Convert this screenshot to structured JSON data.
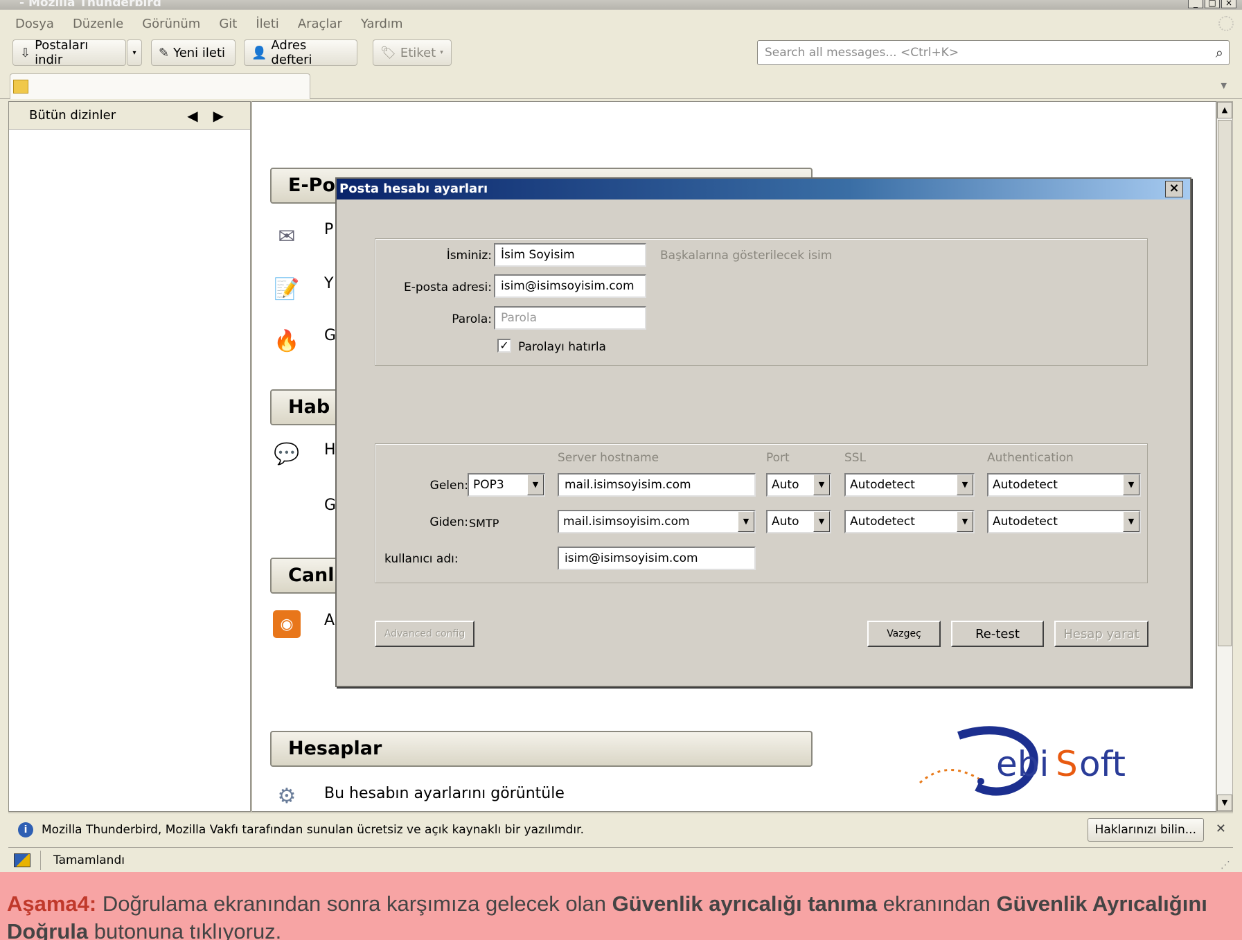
{
  "window": {
    "title": "- Mozilla Thunderbird"
  },
  "menubar": {
    "items": [
      "Dosya",
      "Düzenle",
      "Görünüm",
      "Git",
      "İleti",
      "Araçlar",
      "Yardım"
    ]
  },
  "toolbar": {
    "get_mail": "Postaları indir",
    "write": "Yeni ileti",
    "address_book": "Adres defteri",
    "tag": "Etiket",
    "search_placeholder": "Search all messages... <Ctrl+K>"
  },
  "folder_pane": {
    "header": "Bütün dizinler"
  },
  "home": {
    "sections": [
      {
        "title": "E-Po",
        "items": [
          "P",
          "Y",
          "G"
        ]
      },
      {
        "title": "Hab",
        "items": [
          "H",
          "G"
        ]
      },
      {
        "title": "Canl",
        "items": [
          "A"
        ]
      },
      {
        "title": "Hesaplar",
        "items": [
          "Bu hesabın ayarlarını görüntüle"
        ]
      }
    ]
  },
  "dialog": {
    "title": "Posta hesabı ayarları",
    "name_label": "İsminiz:",
    "name_value": "İsim Soyisim",
    "name_hint": "Başkalarına gösterilecek isim",
    "email_label": "E-posta adresi:",
    "email_value": "isim@isimsoyisim.com",
    "password_label": "Parola:",
    "password_placeholder": "Parola",
    "remember_label": "Parolayı hatırla",
    "col_hostname": "Server hostname",
    "col_port": "Port",
    "col_ssl": "SSL",
    "col_auth": "Authentication",
    "incoming_label": "Gelen:",
    "incoming_protocol": "POP3",
    "incoming_host": "mail.isimsoyisim.com",
    "incoming_port": "Auto",
    "incoming_ssl": "Autodetect",
    "incoming_auth": "Autodetect",
    "outgoing_label": "Giden:",
    "outgoing_protocol": "SMTP",
    "outgoing_host": "mail.isimsoyisim.com",
    "outgoing_port": "Auto",
    "outgoing_ssl": "Autodetect",
    "outgoing_auth": "Autodetect",
    "username_label": "kullanıcı adı:",
    "username_value": "isim@isimsoyisim.com",
    "advanced_button": "Advanced config",
    "cancel_button": "Vazgeç",
    "retest_button": "Re-test",
    "create_button": "Hesap yarat"
  },
  "notification": {
    "text": "Mozilla Thunderbird, Mozilla Vakfı tarafından sunulan ücretsiz ve açık kaynaklı bir yazılımdır.",
    "button": "Haklarınızı bilin..."
  },
  "status": {
    "text": "Tamamlandı"
  },
  "caption": {
    "step": "Aşama4:",
    "part1": " Doğrulama ekranından sonra karşımıza gelecek olan ",
    "bold1": "Güvenlik ayrıcalığı tanıma",
    "part2": " ekranından ",
    "bold2": "Güvenlik Ayrıcalığını Doğrula",
    "part3": " butonuna tıklıyoruz."
  },
  "logo": {
    "text": "DebiSoft"
  }
}
